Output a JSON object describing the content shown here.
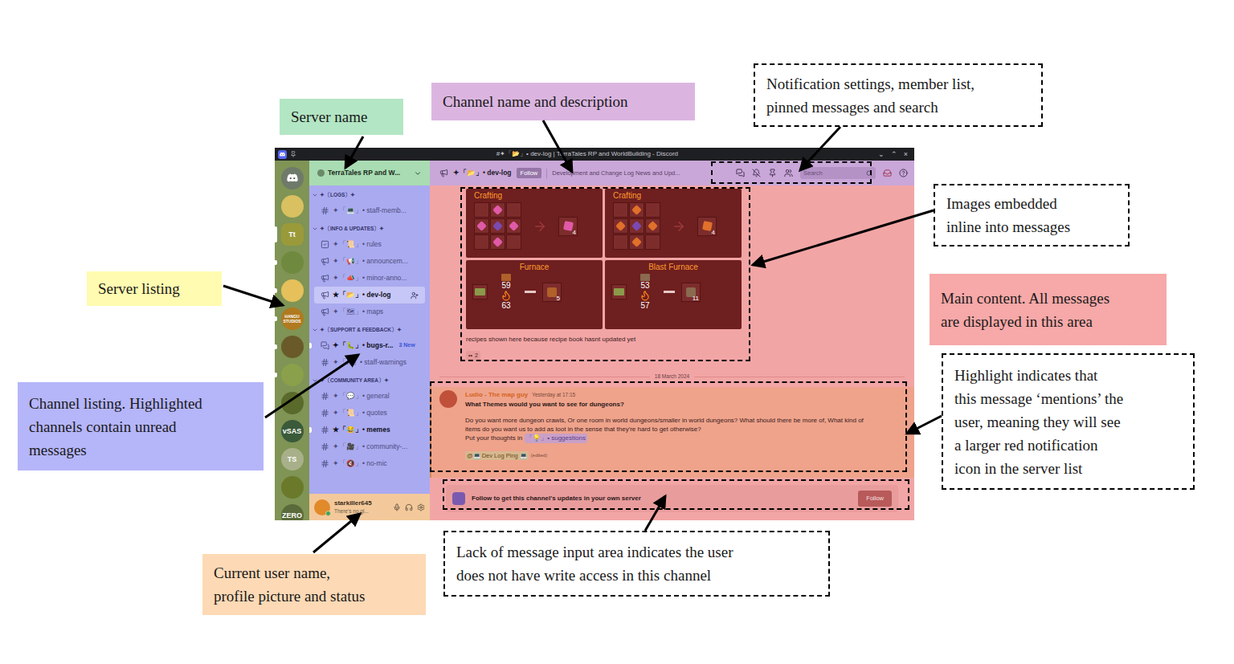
{
  "figure": {
    "callouts": [
      {
        "kind": "filled",
        "color": "#b3e6c4",
        "lines": [
          "Server name"
        ]
      },
      {
        "kind": "filled",
        "color": "#dbb5e0",
        "lines": [
          "Channel name and description"
        ]
      },
      {
        "kind": "dashed",
        "color": "#ffffff",
        "lines": [
          "Notification settings, member list,",
          "pinned messages and search"
        ]
      },
      {
        "kind": "dashed",
        "color": "#ffffff",
        "lines": [
          "Images embedded",
          "inline into messages"
        ]
      },
      {
        "kind": "filled",
        "color": "#fffbb0",
        "lines": [
          "Server listing"
        ]
      },
      {
        "kind": "filled",
        "color": "#f7a8a8",
        "lines": [
          "Main content. All messages",
          "are displayed in this area"
        ]
      },
      {
        "kind": "dashed",
        "color": "#ffffff",
        "lines": [
          "Highlight indicates that",
          "this message ‘mentions’ the",
          "user, meaning they will see",
          "a larger red notification",
          "icon in the server list"
        ]
      },
      {
        "kind": "filled",
        "color": "#b5b5fa",
        "lines": [
          "Channel listing. Highlighted",
          "channels contain unread",
          "messages"
        ]
      },
      {
        "kind": "filled",
        "color": "#fdd9b5",
        "lines": [
          "Current user name,",
          "profile picture and status"
        ]
      },
      {
        "kind": "dashed",
        "color": "#ffffff",
        "lines": [
          "Lack of message input area indicates the user",
          "does not have write access in this channel"
        ]
      }
    ]
  },
  "window": {
    "title": "#✦「📂」• dev-log | TerraTales RP and WorldBuilding - Discord",
    "controls": [
      "⌄",
      "⌃",
      "×"
    ]
  },
  "servers": [
    {
      "kind": "home",
      "label": "",
      "color": "#6f7a6a",
      "selected": false,
      "unread": false
    },
    {
      "kind": "server",
      "label": "",
      "color": "#d9c060",
      "selected": false,
      "unread": false
    },
    {
      "kind": "server",
      "label": "Tt",
      "color": "#9a9a3a",
      "selected": true,
      "unread": false
    },
    {
      "kind": "server",
      "label": "",
      "color": "#6f8a3f",
      "selected": false,
      "unread": true
    },
    {
      "kind": "server",
      "label": "",
      "color": "#e6c05a",
      "selected": false,
      "unread": true
    },
    {
      "kind": "server",
      "label": "HANGU STUDIOS",
      "color": "#b07a20",
      "selected": false,
      "unread": true
    },
    {
      "kind": "server",
      "label": "",
      "color": "#6a5a2a",
      "selected": false,
      "unread": true
    },
    {
      "kind": "server",
      "label": "",
      "color": "#8aa04a",
      "selected": false,
      "unread": true
    },
    {
      "kind": "server",
      "label": "",
      "color": "#5a6a2a",
      "selected": false,
      "unread": false
    },
    {
      "kind": "server",
      "label": "vSAS",
      "color": "#3a5a3a",
      "selected": false,
      "unread": false
    },
    {
      "kind": "server",
      "label": "TS",
      "color": "#a8b08a",
      "selected": false,
      "unread": false
    },
    {
      "kind": "server",
      "label": "",
      "color": "#6a7a2a",
      "selected": false,
      "unread": false
    },
    {
      "kind": "server",
      "label": "ZERO",
      "color": "#5a6a3a",
      "selected": false,
      "unread": false
    }
  ],
  "sidebar": {
    "server_name": "TerraTales RP and W...",
    "categories": [
      {
        "name": "✦〔LOGS〕✦",
        "expanded": true,
        "channels": [
          {
            "kind": "text",
            "name": "✦「💻」• staff-memb...",
            "selected": false,
            "unread": false,
            "badge": ""
          }
        ]
      },
      {
        "name": "✦〔INFO & UPDATES〕✦",
        "expanded": true,
        "channels": [
          {
            "kind": "rules",
            "name": "✦「📜」• rules",
            "selected": false,
            "unread": false,
            "badge": ""
          },
          {
            "kind": "announcement",
            "name": "✦「📢」• announcem...",
            "selected": false,
            "unread": false,
            "badge": ""
          },
          {
            "kind": "announcement",
            "name": "✦「📣」• minor-anno...",
            "selected": false,
            "unread": false,
            "badge": ""
          },
          {
            "kind": "announcement",
            "name": "★「📂」• dev-log",
            "selected": true,
            "unread": false,
            "badge": ""
          },
          {
            "kind": "announcement",
            "name": "✦「🗺」• maps",
            "selected": false,
            "unread": false,
            "badge": ""
          }
        ]
      },
      {
        "name": "✦〔SUPPORT & FEEDBACK〕✦",
        "expanded": true,
        "channels": [
          {
            "kind": "forum",
            "name": "✦「🐛」• bugs-r...",
            "selected": false,
            "unread": true,
            "badge": "3 New"
          },
          {
            "kind": "text",
            "name": "✦「⚠」• staff-warnings",
            "selected": false,
            "unread": false,
            "badge": ""
          }
        ]
      },
      {
        "name": "✦〔COMMUNITY AREA〕✦",
        "expanded": true,
        "channels": [
          {
            "kind": "text",
            "name": "✦「💬」• general",
            "selected": false,
            "unread": false,
            "badge": ""
          },
          {
            "kind": "text",
            "name": "✦「📜」• quotes",
            "selected": false,
            "unread": false,
            "badge": ""
          },
          {
            "kind": "text",
            "name": "★「😂」• memes",
            "selected": false,
            "unread": true,
            "badge": ""
          },
          {
            "kind": "text",
            "name": "✦「🎥」• community-...",
            "selected": false,
            "unread": false,
            "badge": ""
          },
          {
            "kind": "text",
            "name": "✦「🔇」• no-mic",
            "selected": false,
            "unread": false,
            "badge": ""
          }
        ]
      }
    ]
  },
  "user": {
    "name": "starkiller645",
    "status": "There's no gl...",
    "online": true
  },
  "channel_header": {
    "name": "✦「📂」• dev-log",
    "follow": "Follow",
    "description": "Development and Change Log News and Upd...",
    "search_placeholder": "Search"
  },
  "recipes": [
    {
      "kind": "crafting",
      "title": "Crafting",
      "filled": [
        false,
        true,
        false,
        true,
        true,
        true,
        false,
        true,
        false
      ],
      "item_color": "#e05aa8",
      "center_color": "#7a4ab0",
      "output": "4",
      "top": "",
      "bottom": ""
    },
    {
      "kind": "crafting",
      "title": "Crafting",
      "filled": [
        false,
        true,
        false,
        true,
        true,
        true,
        false,
        true,
        false
      ],
      "item_color": "#e0702a",
      "center_color": "#7a4ab0",
      "output": "4",
      "top": "",
      "bottom": ""
    },
    {
      "kind": "furnace",
      "title": "Furnace",
      "filled": [],
      "item_color": "#b0602a",
      "center_color": "#6a7a2a",
      "output": "5",
      "top": "59",
      "bottom": "63"
    },
    {
      "kind": "furnace",
      "title": "Blast Furnace",
      "filled": [],
      "item_color": "#8a6a50",
      "center_color": "#6a7a2a",
      "output": "11",
      "top": "53",
      "bottom": "57"
    }
  ],
  "image_message": {
    "caption": "recipes shown here because recipe book hasnt updated yet",
    "reaction": {
      "emoji": "••",
      "count": "2"
    }
  },
  "date_divider": "18 March 2024",
  "message": {
    "author": "Ludio - The map guy",
    "time": "Yesterday at 17:15",
    "title": "What Themes would you want to see for dungeons?",
    "body": "Do you want more dungeon crawls, Or one room in world dungeons/smaller in world dungeons? What should there be more of, What kind of items do you want us to add as loot in the sense that they're hard to get otherwise?",
    "prompt": "Put your thoughts in",
    "channel_mention": "「💡」• suggestions",
    "role_mention": "@💻 Dev Log Ping 💻",
    "edited": "(edited)",
    "mentions_user": true
  },
  "follow_bar": {
    "text": "Follow to get this channel's updates in your own server",
    "button": "Follow"
  }
}
